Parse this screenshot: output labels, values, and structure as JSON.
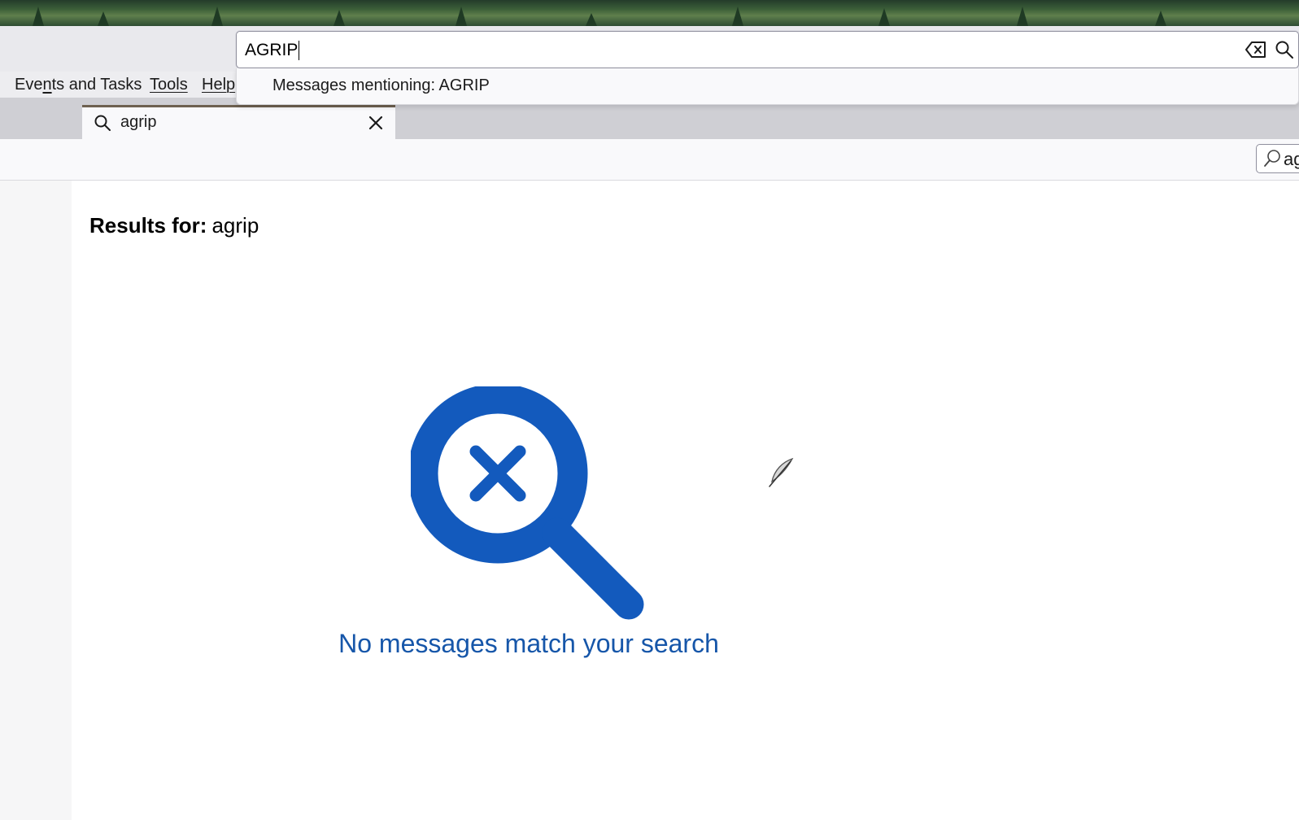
{
  "menubar": {
    "items": [
      {
        "label": "Events and Tasks"
      },
      {
        "label": "Tools"
      },
      {
        "label": "Help"
      }
    ]
  },
  "global_search": {
    "value": "AGRIP",
    "suggestion": "Messages mentioning: AGRIP"
  },
  "tab": {
    "label": "agrip"
  },
  "quick_filter": {
    "value": "ag"
  },
  "results": {
    "heading": "Results for:",
    "term": "agrip",
    "empty_message": "No messages match your search"
  },
  "colors": {
    "accent_blue": "#1656a9",
    "icon_blue": "#135abd",
    "tab_indicator": "#6e6150"
  }
}
